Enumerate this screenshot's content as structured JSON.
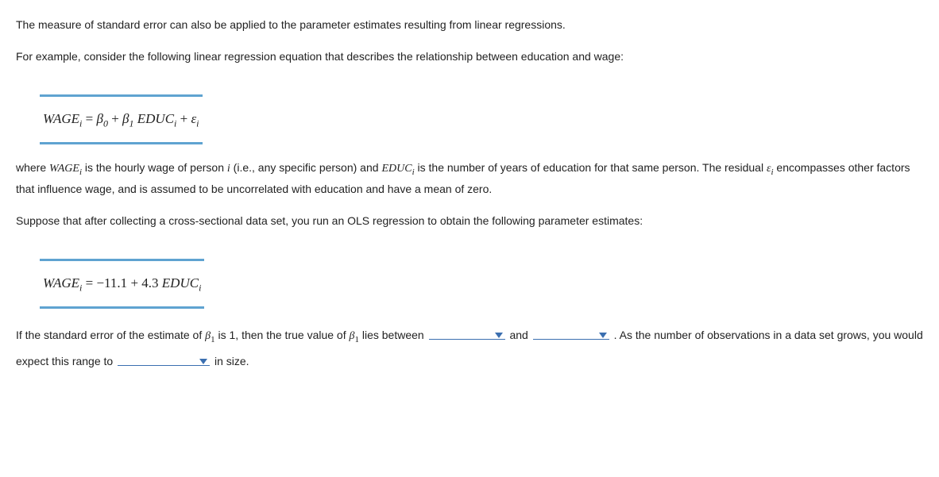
{
  "p1": "The measure of standard error can also be applied to the parameter estimates resulting from linear regressions.",
  "p2": "For example, consider the following linear regression equation that describes the relationship between education and wage:",
  "eq1": {
    "wage": "WAGE",
    "sub_i1": "i",
    "eq": " = ",
    "b0": "β",
    "b0s": "0",
    "plus1": " + ",
    "b1": "β",
    "b1s": "1",
    "sp": " ",
    "educ": "EDUC",
    "sub_i2": "i",
    "plus2": " + ",
    "eps": "ε",
    "sub_i3": "i"
  },
  "p3": {
    "a": "where ",
    "wage": "WAGE",
    "wage_sub": "i",
    "b": " is the hourly wage of person ",
    "i": "i",
    "c": " (i.e., any specific person) and ",
    "educ": "EDUC",
    "educ_sub": "i",
    "d": " is the number of years of education for that same person. The residual ",
    "eps": "ε",
    "eps_sub": "i",
    "e": " encompasses other factors that influence wage, and is assumed to be uncorrelated with education and have a mean of zero."
  },
  "p4": "Suppose that after collecting a cross-sectional data set, you run an OLS regression to obtain the following parameter estimates:",
  "eq2": {
    "wage": "WAGE",
    "sub_i1": "i",
    "eq": " = ",
    "v1": "−11.1",
    "plus": " + ",
    "v2": "4.3",
    "sp": " ",
    "educ": "EDUC",
    "sub_i2": "i"
  },
  "q": {
    "a": "If the standard error of the estimate of ",
    "b1": "β",
    "b1s": "1",
    "b": " is 1, then the true value of ",
    "b1_2": "β",
    "b1s_2": "1",
    "c": " lies between ",
    "d": " and ",
    "e": " . As the number of observations in a data set grows, you would expect this range to ",
    "f": " in size."
  }
}
